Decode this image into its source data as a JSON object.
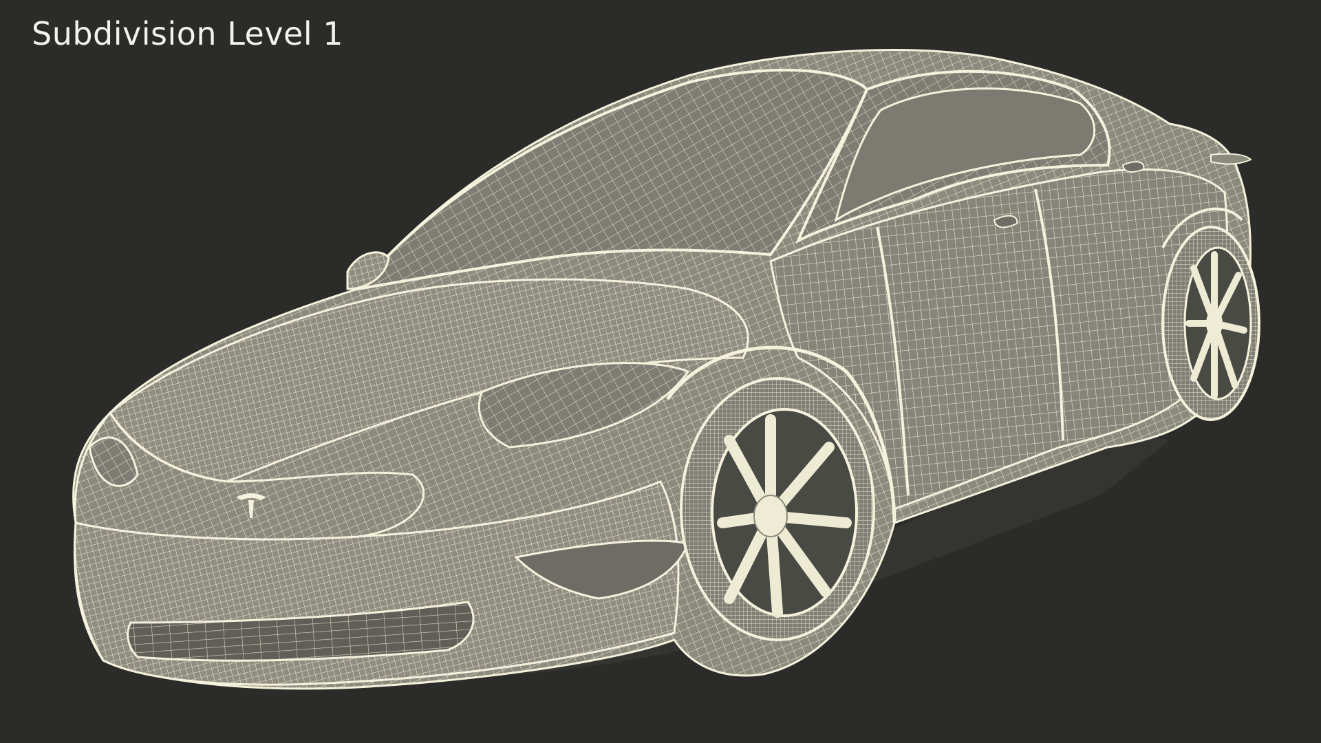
{
  "viewport": {
    "caption": "Subdivision Level 1",
    "background_color": "#2b2b29",
    "mesh_line_color": "#f4f1dc",
    "surface_color": "#8d8c7f"
  },
  "subject": {
    "name_icon": "wireframe-car-render"
  }
}
